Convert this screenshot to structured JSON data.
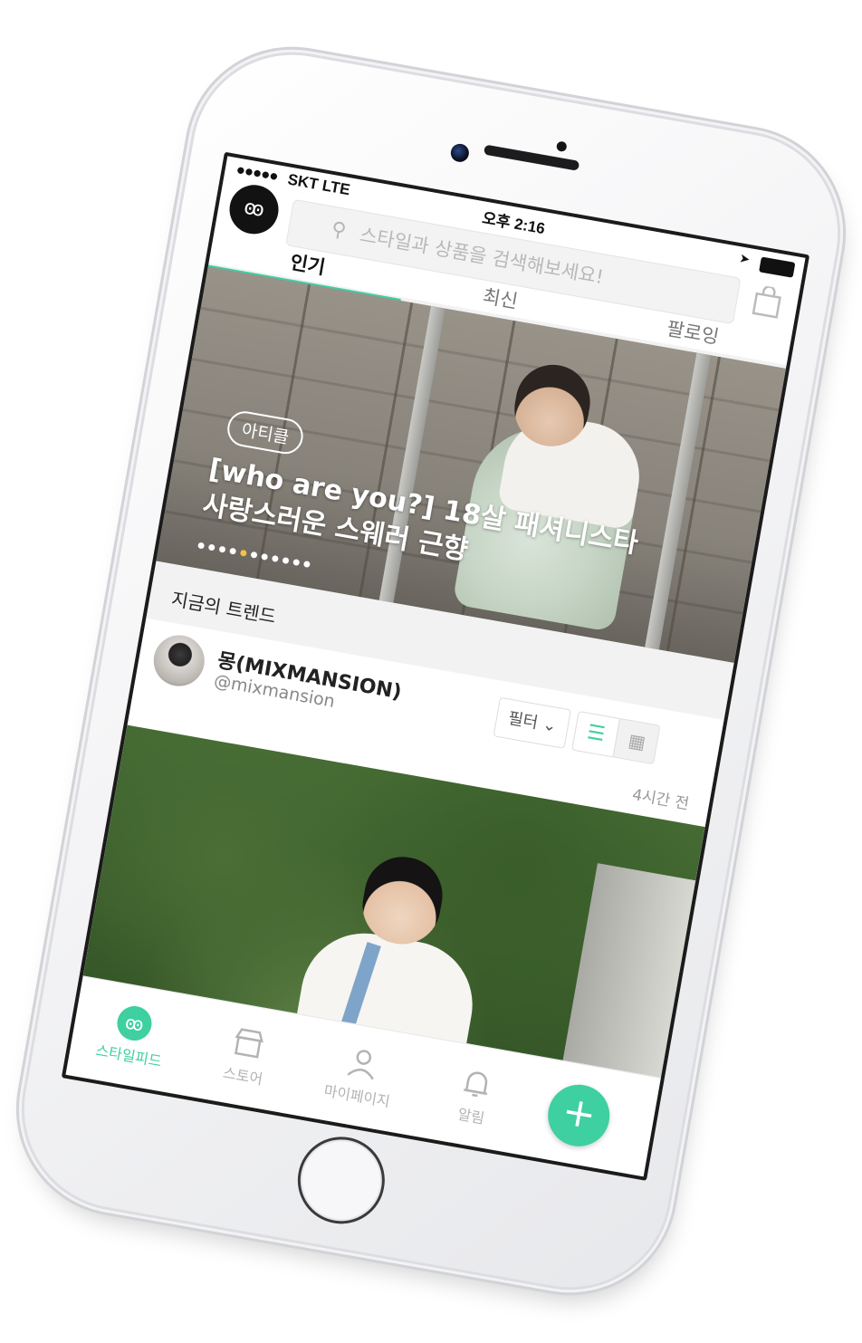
{
  "status_bar": {
    "signal": "●●●●●",
    "carrier": "SKT  LTE",
    "time": "오후 2:16"
  },
  "header": {
    "logo_text": "ꙭ",
    "search_placeholder": "스타일과 상품을 검색해보세요!",
    "tabs": [
      {
        "label": "인기",
        "active": true
      },
      {
        "label": "최신",
        "active": false
      },
      {
        "label": "팔로잉",
        "active": false
      }
    ]
  },
  "banner": {
    "badge": "아티클",
    "title": "[who are you?] 18살 패셔니스타 사랑스러운 스웨러 근향",
    "dots": "● ● ● ● ● ● ● ● ● ● ●",
    "active_dot": 4
  },
  "trend": {
    "section_title": "지금의 트렌드"
  },
  "post": {
    "user_name": "몽(MIXMANSION)",
    "user_handle": "@mixmansion",
    "filter_label": "필터 ⌄",
    "list_icon": "☰",
    "grid_icon": "▦",
    "time": "4시간 전"
  },
  "bottom_nav": {
    "items": [
      {
        "label": "스타일피드",
        "icon": "style-feed-icon",
        "active": true
      },
      {
        "label": "스토어",
        "icon": "store-icon",
        "active": false
      },
      {
        "label": "마이페이지",
        "icon": "person-icon",
        "active": false
      },
      {
        "label": "알림",
        "icon": "bell-icon",
        "active": false
      }
    ],
    "fab_label": "+"
  },
  "colors": {
    "accent": "#3ed0a0"
  }
}
